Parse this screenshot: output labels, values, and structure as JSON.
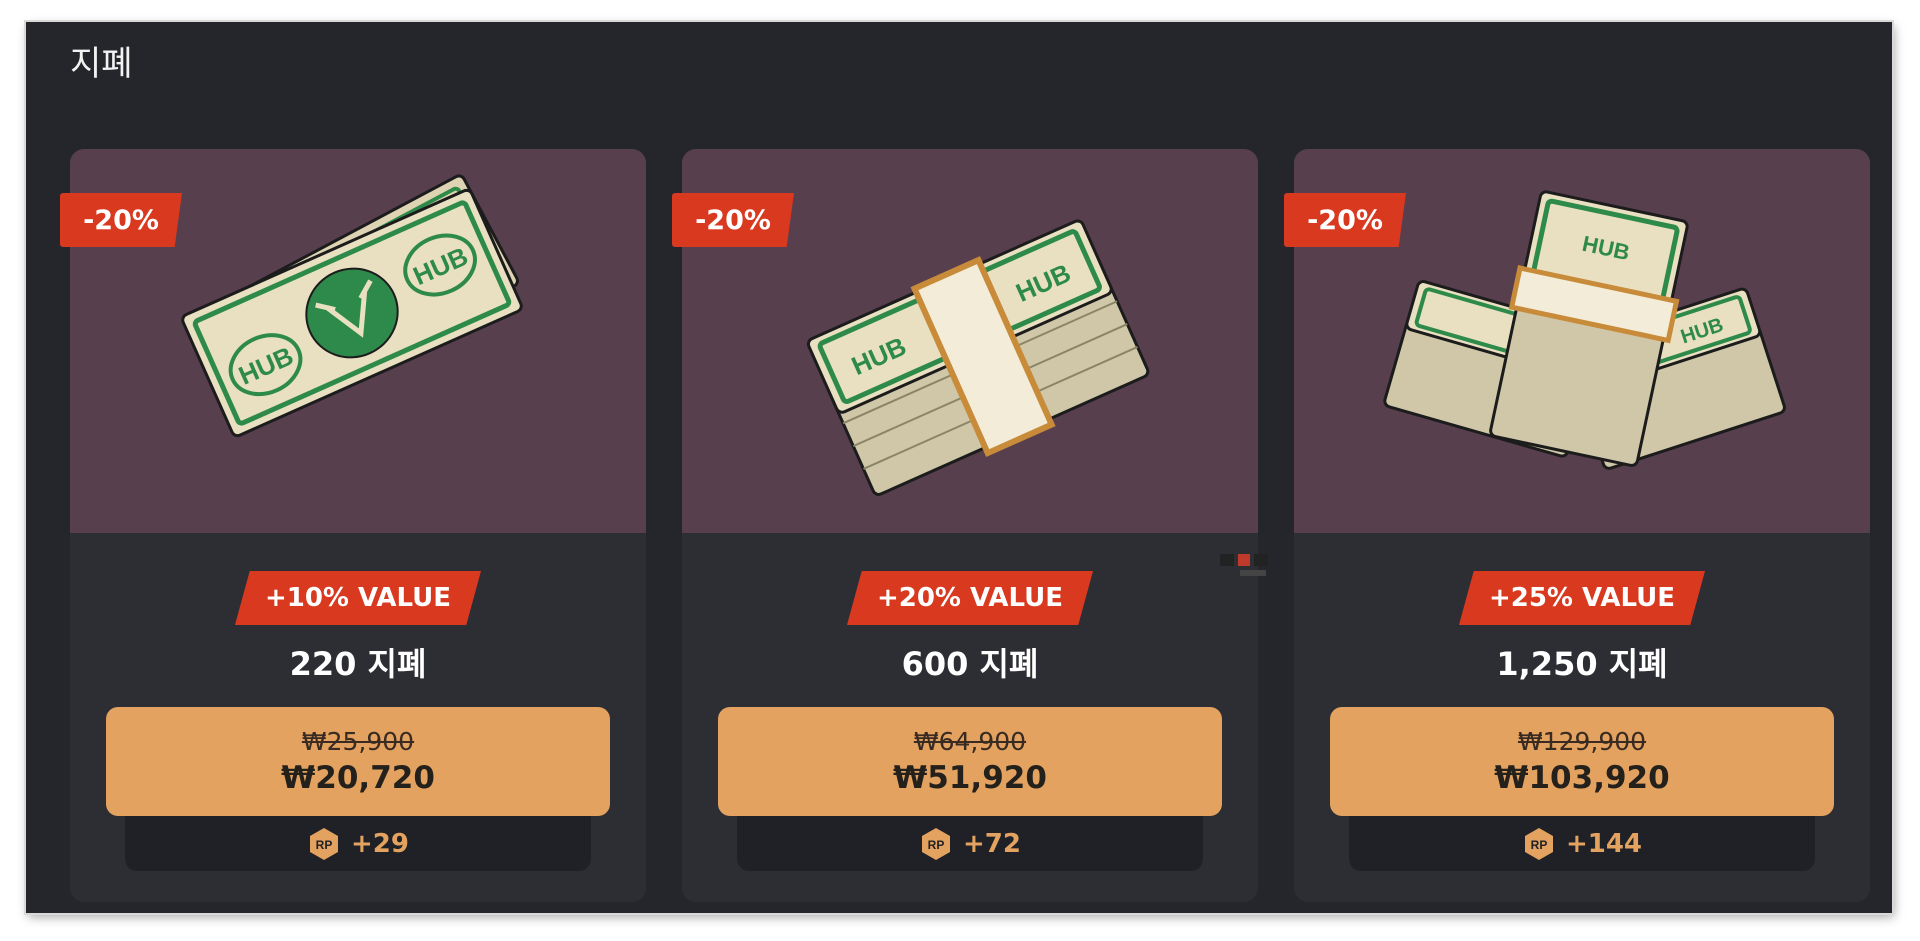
{
  "section": {
    "title": "지폐"
  },
  "cards": [
    {
      "discount": "-20%",
      "value_badge": "+10% VALUE",
      "amount": "220 지폐",
      "old_price": "₩25,900",
      "new_price": "₩20,720",
      "rp_label": "RP",
      "rp_bonus": "+29",
      "image": "single-banknote"
    },
    {
      "discount": "-20%",
      "value_badge": "+20% VALUE",
      "amount": "600 지폐",
      "old_price": "₩64,900",
      "new_price": "₩51,920",
      "rp_label": "RP",
      "rp_bonus": "+72",
      "image": "banknote-bundle"
    },
    {
      "discount": "-20%",
      "value_badge": "+25% VALUE",
      "amount": "1,250 지폐",
      "old_price": "₩129,900",
      "new_price": "₩103,920",
      "rp_label": "RP",
      "rp_bonus": "+144",
      "image": "banknote-pile"
    }
  ],
  "note_label": "HUB",
  "colors": {
    "page_bg": "#25262b",
    "card_bg": "#2d2e34",
    "image_bg": "#573f4e",
    "badge_red": "#d9391f",
    "price_orange": "#e3a25f",
    "note_green": "#2e8a4a",
    "note_paper": "#e9e0c2"
  }
}
